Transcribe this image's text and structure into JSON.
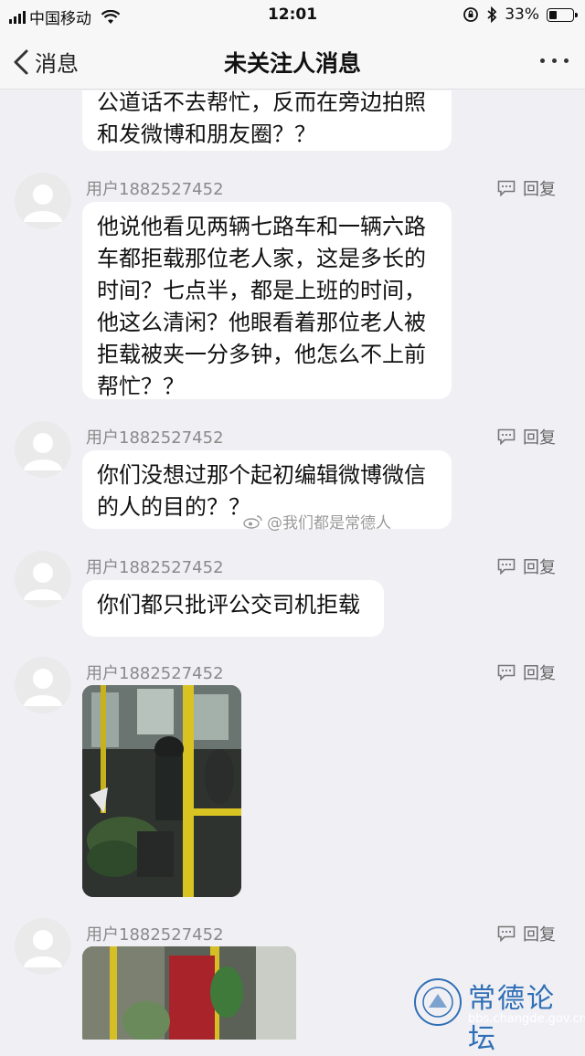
{
  "status_bar": {
    "carrier": "中国移动",
    "time": "12:01",
    "battery": "33%"
  },
  "nav": {
    "back_label": "消息",
    "title": "未关注人消息"
  },
  "messages": [
    {
      "lines": [
        "公道话不去帮忙，反而在旁边拍照",
        "和发微博和朋友圈？？"
      ]
    },
    {
      "user": "用户1882527452",
      "reply": "回复",
      "lines": [
        "他说他看见两辆七路车和一辆六路",
        "车都拒载那位老人家，这是多长的",
        "时间？七点半，都是上班的时间，",
        "他这么清闲？他眼看着那位老人被",
        "拒载被夹一分多钟，他怎么不上前",
        "帮忙？？"
      ]
    },
    {
      "user": "用户1882527452",
      "reply": "回复",
      "lines": [
        "你们没想过那个起初编辑微博微信",
        "的人的目的？？"
      ]
    },
    {
      "user": "用户1882527452",
      "reply": "回复",
      "lines": [
        "你们都只批评公交司机拒载"
      ]
    },
    {
      "user": "用户1882527452",
      "reply": "回复"
    },
    {
      "user": "用户1882527452",
      "reply": "回复"
    }
  ],
  "watermark": "@我们都是常德人",
  "forum": {
    "name": "常德论坛",
    "url": "bbs.changde.gov.cn"
  },
  "colors": {
    "background": "#f0eff4",
    "bubble": "#ffffff",
    "username": "#8a8a8a",
    "forum_blue": "#2f6fb5"
  }
}
